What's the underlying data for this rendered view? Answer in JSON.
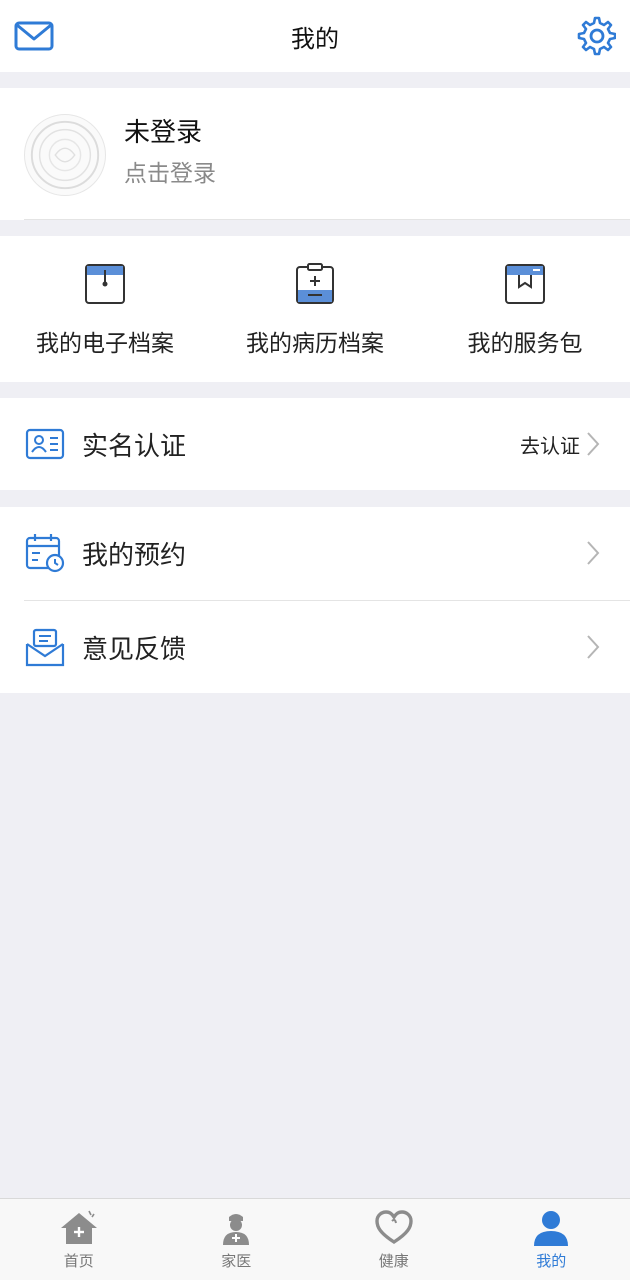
{
  "header": {
    "title": "我的",
    "mail_icon": "mail-icon",
    "settings_icon": "gear-icon"
  },
  "profile": {
    "name": "未登录",
    "subtitle": "点击登录"
  },
  "shortcuts": [
    {
      "label": "我的电子档案",
      "icon": "archive-icon"
    },
    {
      "label": "我的病历档案",
      "icon": "medical-record-icon"
    },
    {
      "label": "我的服务包",
      "icon": "service-package-icon"
    }
  ],
  "verify": {
    "label": "实名认证",
    "action": "去认证"
  },
  "menu": [
    {
      "label": "我的预约",
      "icon": "calendar-clock-icon"
    },
    {
      "label": "意见反馈",
      "icon": "feedback-envelope-icon"
    }
  ],
  "tabbar": [
    {
      "label": "首页",
      "icon": "home-icon"
    },
    {
      "label": "家医",
      "icon": "doctor-icon"
    },
    {
      "label": "健康",
      "icon": "heart-icon"
    },
    {
      "label": "我的",
      "icon": "user-icon",
      "active": true
    }
  ],
  "colors": {
    "accent": "#2f7bd6",
    "background": "#efeff4",
    "tab_inactive": "#8c8c8c"
  }
}
